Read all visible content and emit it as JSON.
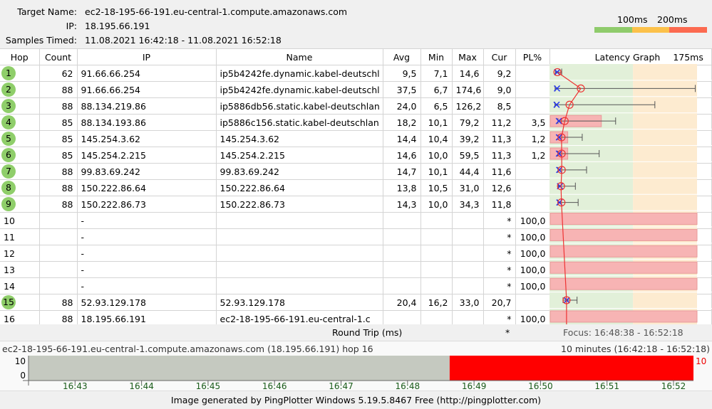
{
  "header": {
    "target_label": "Target Name:",
    "target": "ec2-18-195-66-191.eu-central-1.compute.amazonaws.com",
    "ip_label": "IP:",
    "ip": "18.195.66.191",
    "samples_label": "Samples Timed:",
    "samples": "11.08.2021 16:42:18 - 11.08.2021 16:52:18",
    "legend_100": "100ms",
    "legend_200": "200ms",
    "legend_colors": [
      "#8fcb6b",
      "#fcc14a",
      "#fc6a50"
    ]
  },
  "columns": [
    "Hop",
    "Count",
    "IP",
    "Name",
    "Avg",
    "Min",
    "Max",
    "Cur",
    "PL%",
    "Latency Graph",
    "175ms"
  ],
  "rows": [
    {
      "hop": "1",
      "count": "62",
      "ip": "91.66.66.254",
      "name": "ip5b4242fe.dynamic.kabel-deutschl",
      "avg": "9,5",
      "min": "7,1",
      "max": "14,6",
      "cur": "9,2",
      "pl": "",
      "circle": true
    },
    {
      "hop": "2",
      "count": "88",
      "ip": "91.66.66.254",
      "name": "ip5b4242fe.dynamic.kabel-deutschl",
      "avg": "37,5",
      "min": "6,7",
      "max": "174,6",
      "cur": "9,0",
      "pl": "",
      "circle": true
    },
    {
      "hop": "3",
      "count": "88",
      "ip": "88.134.219.86",
      "name": "ip5886db56.static.kabel-deutschlan",
      "avg": "24,0",
      "min": "6,5",
      "max": "126,2",
      "cur": "8,5",
      "pl": "",
      "circle": true
    },
    {
      "hop": "4",
      "count": "85",
      "ip": "88.134.193.86",
      "name": "ip5886c156.static.kabel-deutschlan",
      "avg": "18,2",
      "min": "10,1",
      "max": "79,2",
      "cur": "11,2",
      "pl": "3,5",
      "circle": true
    },
    {
      "hop": "5",
      "count": "85",
      "ip": "145.254.3.62",
      "name": "145.254.3.62",
      "avg": "14,4",
      "min": "10,4",
      "max": "39,2",
      "cur": "11,3",
      "pl": "1,2",
      "circle": true
    },
    {
      "hop": "6",
      "count": "85",
      "ip": "145.254.2.215",
      "name": "145.254.2.215",
      "avg": "14,6",
      "min": "10,0",
      "max": "59,5",
      "cur": "11,3",
      "pl": "1,2",
      "circle": true
    },
    {
      "hop": "7",
      "count": "88",
      "ip": "99.83.69.242",
      "name": "99.83.69.242",
      "avg": "14,7",
      "min": "10,1",
      "max": "44,4",
      "cur": "11,6",
      "pl": "",
      "circle": true
    },
    {
      "hop": "8",
      "count": "88",
      "ip": "150.222.86.64",
      "name": "150.222.86.64",
      "avg": "13,8",
      "min": "10,5",
      "max": "31,0",
      "cur": "12,6",
      "pl": "",
      "circle": true
    },
    {
      "hop": "9",
      "count": "88",
      "ip": "150.222.86.73",
      "name": "150.222.86.73",
      "avg": "14,3",
      "min": "10,0",
      "max": "34,3",
      "cur": "11,8",
      "pl": "",
      "circle": true
    },
    {
      "hop": "10",
      "count": "",
      "ip": "-",
      "name": "",
      "avg": "",
      "min": "",
      "max": "",
      "cur": "*",
      "pl": "100,0",
      "circle": false
    },
    {
      "hop": "11",
      "count": "",
      "ip": "-",
      "name": "",
      "avg": "",
      "min": "",
      "max": "",
      "cur": "*",
      "pl": "100,0",
      "circle": false
    },
    {
      "hop": "12",
      "count": "",
      "ip": "-",
      "name": "",
      "avg": "",
      "min": "",
      "max": "",
      "cur": "*",
      "pl": "100,0",
      "circle": false
    },
    {
      "hop": "13",
      "count": "",
      "ip": "-",
      "name": "",
      "avg": "",
      "min": "",
      "max": "",
      "cur": "*",
      "pl": "100,0",
      "circle": false
    },
    {
      "hop": "14",
      "count": "",
      "ip": "-",
      "name": "",
      "avg": "",
      "min": "",
      "max": "",
      "cur": "*",
      "pl": "100,0",
      "circle": false
    },
    {
      "hop": "15",
      "count": "88",
      "ip": "52.93.129.178",
      "name": "52.93.129.178",
      "avg": "20,4",
      "min": "16,2",
      "max": "33,0",
      "cur": "20,7",
      "pl": "",
      "circle": true
    },
    {
      "hop": "16",
      "count": "88",
      "ip": "18.195.66.191",
      "name": "ec2-18-195-66-191.eu-central-1.c",
      "avg": "",
      "min": "",
      "max": "",
      "cur": "*",
      "pl": "100,0",
      "circle": false
    }
  ],
  "graph": {
    "max_ms": 175,
    "green_until_ms": 100,
    "zone_colors": [
      "#e2f0d9",
      "#fdebd0"
    ]
  },
  "round_trip": {
    "label": "Round Trip (ms)",
    "cur": "*",
    "focus": "Focus: 16:48:38 - 16:52:18"
  },
  "timeline": {
    "title": "ec2-18-195-66-191.eu-central-1.compute.amazonaws.com (18.195.66.191) hop 16",
    "range": "10 minutes (16:42:18 - 16:52:18)",
    "y_top": "10",
    "y_bottom": "0",
    "right_value": "10",
    "ticks": [
      "16:43",
      "16:44",
      "16:45",
      "16:46",
      "16:47",
      "16:48",
      "16:49",
      "16:50",
      "16:51",
      "16:52"
    ],
    "loss_from": "16:48:38"
  },
  "footer": "Image generated by PingPlotter Windows 5.19.5.8467 Free (http://pingplotter.com)"
}
